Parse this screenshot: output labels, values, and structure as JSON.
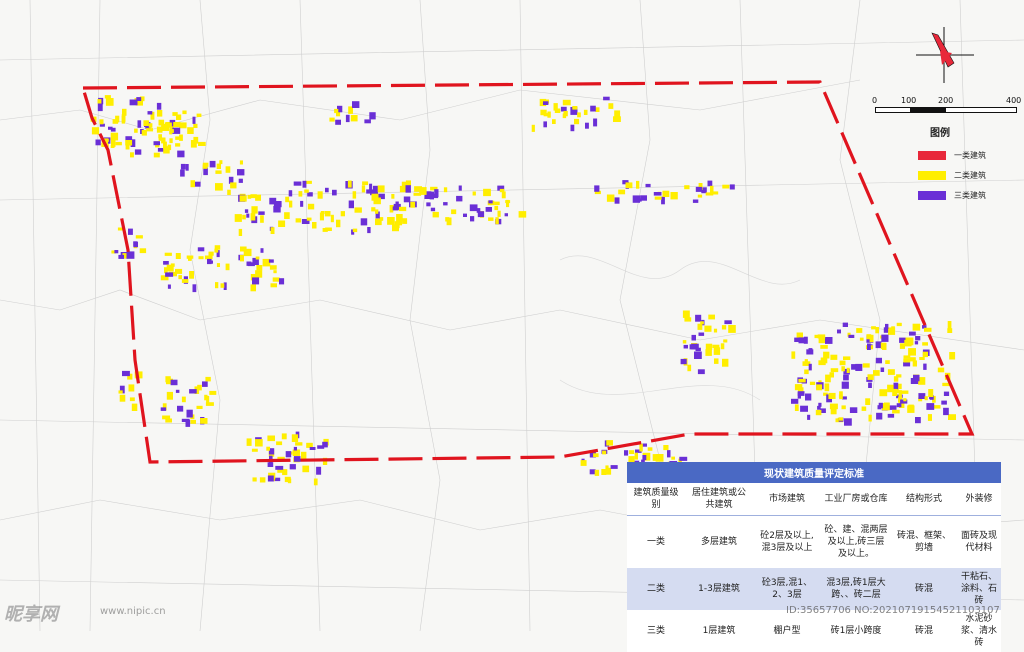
{
  "legend": {
    "title": "图例",
    "items": [
      {
        "label": "一类建筑",
        "color": "#e8283a"
      },
      {
        "label": "二类建筑",
        "color": "#ffee00"
      },
      {
        "label": "三类建筑",
        "color": "#6a2fd6"
      }
    ]
  },
  "scale": {
    "ticks": [
      "0",
      "100",
      "200",
      "400"
    ]
  },
  "boundary_color": "#e0141e",
  "table": {
    "title": "现状建筑质量评定标准",
    "header_color": "#4a69c4",
    "headers": [
      "建筑质量级别",
      "居住建筑或公共建筑",
      "市场建筑",
      "工业厂房或仓库",
      "结构形式",
      "外装修"
    ],
    "rows": [
      [
        "一类",
        "多层建筑",
        "砼2层及以上,混3层及以上",
        "砼、建、混两层及以上,砖三层及以上。",
        "砖混、框架、剪墙",
        "面砖及现代材料"
      ],
      [
        "二类",
        "1-3层建筑",
        "砼3层,混1、2、3层",
        "混3层,砖1层大跨、、砖二层",
        "砖混",
        "干粘石、涂料、石砖"
      ],
      [
        "三类",
        "1层建筑",
        "棚户型",
        "砖1层小跨度",
        "砖混",
        "水泥砂浆、清水砖"
      ]
    ]
  },
  "watermark": {
    "logo": "昵享网",
    "site": "www.nipic.cn",
    "id": "ID:35657706 NO:20210719154521103107"
  }
}
